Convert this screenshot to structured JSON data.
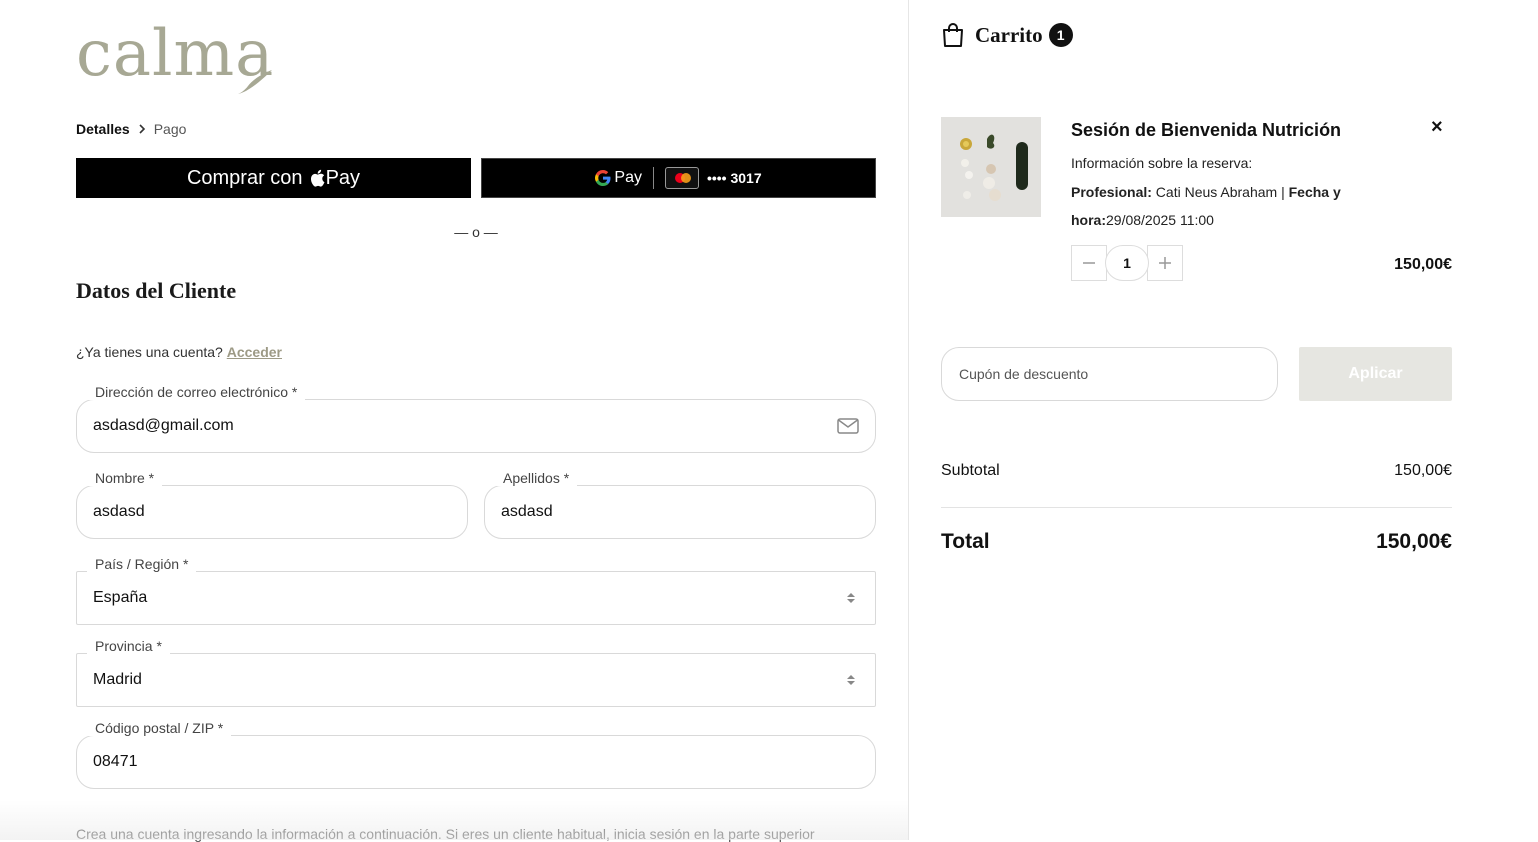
{
  "brand": {
    "logo_text": "calma",
    "accent_color": "#a7a894"
  },
  "breadcrumb": {
    "step1": "Detalles",
    "step2": "Pago"
  },
  "express_pay": {
    "apple_label_prefix": "Comprar con",
    "apple_label_suffix": "Pay",
    "gpay_label": "Pay",
    "card_mask": "•••• 3017"
  },
  "divider_text": "— o —",
  "customer": {
    "title": "Datos del Cliente",
    "account_prompt": "¿Ya tienes una cuenta?",
    "login_link": "Acceder",
    "email": {
      "label": "Dirección de correo electrónico *",
      "value": "asdasd@gmail.com"
    },
    "first_name": {
      "label": "Nombre *",
      "value": "asdasd"
    },
    "last_name": {
      "label": "Apellidos *",
      "value": "asdasd"
    },
    "country": {
      "label": "País / Región *",
      "value": "España"
    },
    "province": {
      "label": "Provincia *",
      "value": "Madrid"
    },
    "zip": {
      "label": "Código postal / ZIP *",
      "value": "08471"
    },
    "create_account_text": "Crea una cuenta ingresando la información a continuación. Si eres un cliente habitual, inicia sesión en la parte superior"
  },
  "cart": {
    "title": "Carrito",
    "count": "1",
    "item": {
      "name": "Sesión de Bienvenida Nutrición",
      "remove": "×",
      "info_title": "Información sobre la reserva:",
      "professional_label": "Profesional:",
      "professional_value": " Cati Neus Abraham | ",
      "date_label": "Fecha y hora:",
      "date_value": "29/08/2025 11:00",
      "quantity": "1",
      "price": "150,00€"
    },
    "coupon_placeholder": "Cupón de descuento",
    "apply_label": "Aplicar",
    "subtotal_label": "Subtotal",
    "subtotal_value": "150,00€",
    "total_label": "Total",
    "total_value": "150,00€"
  }
}
